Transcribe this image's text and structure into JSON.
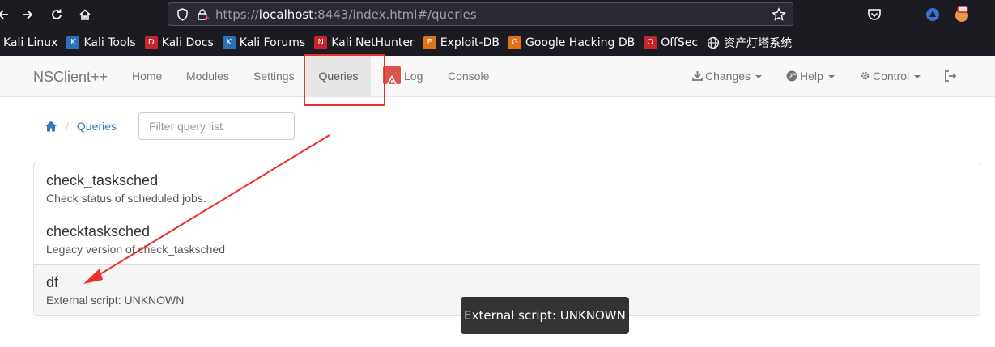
{
  "browser": {
    "url_prefix": "https://",
    "url_host": "localhost",
    "url_rest": ":8443/index.html#/queries",
    "bookmarks": [
      {
        "label": "Kali Linux",
        "icon": "kali-icon",
        "color": "#2d6fb5"
      },
      {
        "label": "Kali Tools",
        "icon": "kali-tools-icon",
        "color": "#2d6fb5"
      },
      {
        "label": "Kali Docs",
        "icon": "kali-docs-icon",
        "color": "#c6252c"
      },
      {
        "label": "Kali Forums",
        "icon": "kali-forums-icon",
        "color": "#2d6fb5"
      },
      {
        "label": "Kali NetHunter",
        "icon": "nethunter-icon",
        "color": "#c6252c"
      },
      {
        "label": "Exploit-DB",
        "icon": "exploit-db-icon",
        "color": "#e0731a"
      },
      {
        "label": "Google Hacking DB",
        "icon": "ghdb-icon",
        "color": "#e0731a"
      },
      {
        "label": "OffSec",
        "icon": "offsec-icon",
        "color": "#c6252c"
      },
      {
        "label": "资产灯塔系统",
        "icon": "globe-icon",
        "color": "#fbfbfe"
      }
    ]
  },
  "navbar": {
    "brand": "NSClient++",
    "items": {
      "home": "Home",
      "modules": "Modules",
      "settings": "Settings",
      "queries": "Queries",
      "log": "Log",
      "console": "Console",
      "changes": "Changes",
      "help": "Help",
      "control": "Control"
    }
  },
  "breadcrumb": {
    "current": "Queries"
  },
  "filter": {
    "placeholder": "Filter query list",
    "value": ""
  },
  "queries": [
    {
      "name": "check_tasksched",
      "description": "Check status of scheduled jobs."
    },
    {
      "name": "checktasksched",
      "description": "Legacy version of check_tasksched"
    },
    {
      "name": "df",
      "description": "External script: UNKNOWN"
    }
  ],
  "tooltip": {
    "text": "External script: UNKNOWN"
  },
  "colors": {
    "annotation": "#e8322a",
    "link": "#337ab7",
    "log_badge": "#d9534f"
  }
}
